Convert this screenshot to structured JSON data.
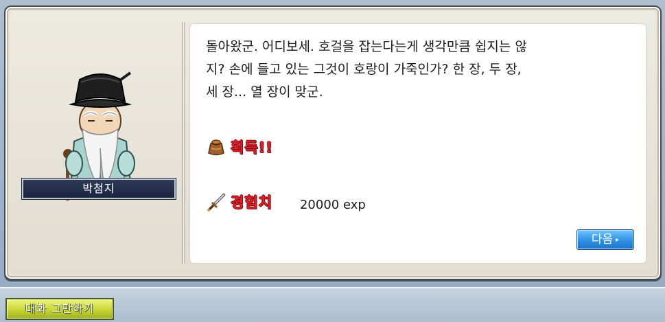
{
  "npc": {
    "name": "박첨지",
    "sprite": "old-scholar-npc"
  },
  "dialog": {
    "lines": [
      "돌아왔군. 어디보세. 호걸을 잡는다는게 생각만큼 쉽지는 않",
      "지? 손에 들고 있는 그것이 호랑이 가죽인가? 한 장, 두 장,",
      "세 장... 열 장이 맞군."
    ]
  },
  "rewards": {
    "acquire_label": "획득!!",
    "acquire_icon": "bag-icon",
    "exp_label": "경험치",
    "exp_icon": "sword-icon",
    "exp_value": "20000 exp"
  },
  "buttons": {
    "next_label": "다음",
    "next_arrow": "▸",
    "end_chat_label": "대화 그만하기"
  },
  "colors": {
    "reward_label": "#e0202a",
    "next_button": "#2f8fe3",
    "end_chat_button": "#c7d636",
    "name_plate": "#1a2440"
  }
}
